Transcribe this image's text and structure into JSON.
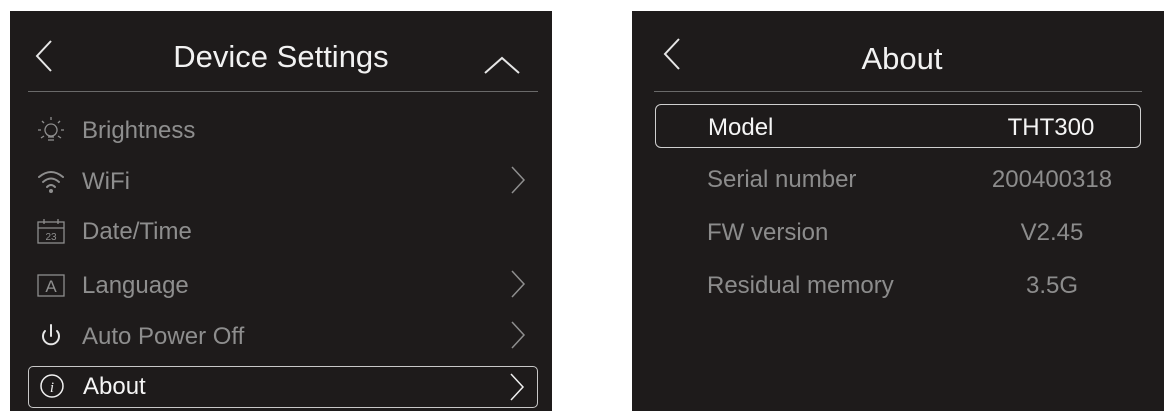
{
  "device_settings": {
    "title": "Device Settings",
    "items": [
      {
        "label": "Brightness",
        "icon": "brightness-icon",
        "has_arrow": false,
        "selected": false
      },
      {
        "label": "WiFi",
        "icon": "wifi-icon",
        "has_arrow": true,
        "selected": false
      },
      {
        "label": "Date/Time",
        "icon": "calendar-icon",
        "icon_text": "23",
        "has_arrow": false,
        "selected": false
      },
      {
        "label": "Language",
        "icon": "language-icon",
        "icon_text": "A",
        "has_arrow": true,
        "selected": false
      },
      {
        "label": "Auto Power Off",
        "icon": "power-icon",
        "has_arrow": true,
        "selected": false
      },
      {
        "label": "About",
        "icon": "info-icon",
        "has_arrow": true,
        "selected": true
      }
    ]
  },
  "about": {
    "title": "About",
    "rows": [
      {
        "key": "Model",
        "value": "THT300",
        "selected": true
      },
      {
        "key": "Serial number",
        "value": "200400318",
        "selected": false
      },
      {
        "key": "FW version",
        "value": "V2.45",
        "selected": false
      },
      {
        "key": "Residual memory",
        "value": "3.5G",
        "selected": false
      }
    ]
  },
  "colors": {
    "screen_background": "#1e1b1b",
    "text_active": "#f5f5f5",
    "text_inactive": "#8e8e8e",
    "selection_border": "#c8c8c8"
  }
}
